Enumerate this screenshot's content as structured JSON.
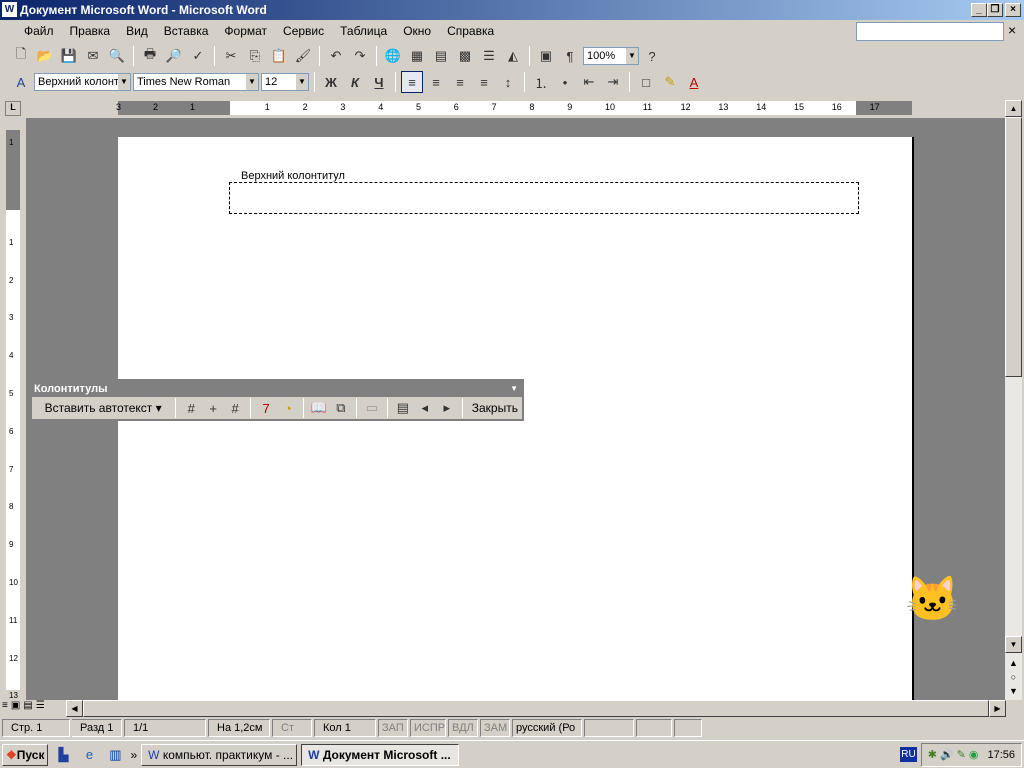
{
  "window": {
    "title": "Документ Microsoft Word - Microsoft Word",
    "help_placeholder": ""
  },
  "menu": [
    "Файл",
    "Правка",
    "Вид",
    "Вставка",
    "Формат",
    "Сервис",
    "Таблица",
    "Окно",
    "Справка"
  ],
  "standard_toolbar": {
    "zoom": "100%"
  },
  "formatting_toolbar": {
    "style": "Верхний колонт",
    "font": "Times New Roman",
    "size": "12",
    "bold": "Ж",
    "italic": "К",
    "underline": "Ч"
  },
  "ruler": {
    "ticks": [
      "3",
      "2",
      "1",
      "1",
      "2",
      "3",
      "4",
      "5",
      "6",
      "7",
      "8",
      "9",
      "10",
      "11",
      "12",
      "13",
      "14",
      "15",
      "16",
      "17"
    ]
  },
  "vruler": {
    "ticks": [
      "1",
      "1",
      "2",
      "3",
      "4",
      "5",
      "6",
      "7",
      "8",
      "9",
      "10",
      "11",
      "12",
      "13"
    ]
  },
  "document": {
    "header_label": "Верхний колонтитул"
  },
  "hf_toolbar": {
    "title": "Колонтитулы",
    "autotext": "Вставить автотекст",
    "close": "Закрыть"
  },
  "status": [
    "Стр. 1",
    "Разд 1",
    "1/1",
    "На 1,2см",
    "Ст",
    "Кол 1",
    "ЗАП",
    "ИСПР",
    "ВДЛ",
    "ЗАМ",
    "русский (Ро"
  ],
  "taskbar": {
    "start": "Пуск",
    "tasks": [
      "компьют. практикум - ...",
      "Документ Microsoft ..."
    ],
    "lang": "RU",
    "clock": "17:56"
  }
}
